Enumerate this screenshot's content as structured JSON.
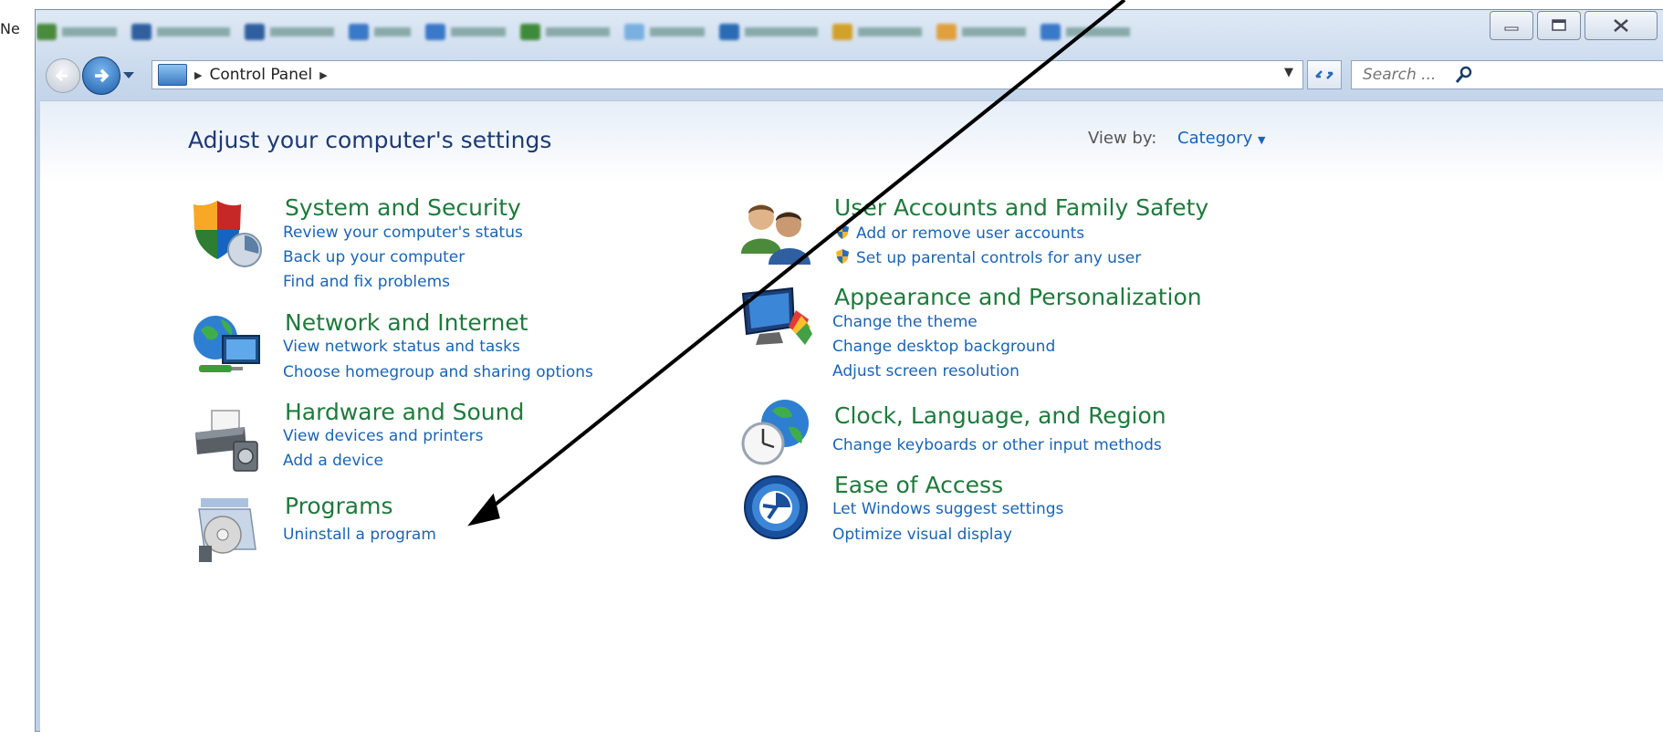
{
  "edge_text": "Ne",
  "window_controls": {
    "minimize": "minimize",
    "maximize": "maximize",
    "close": "close"
  },
  "nav": {
    "address": "Control Panel",
    "search_placeholder": "Search ..."
  },
  "main": {
    "heading": "Adjust your computer's settings",
    "view_by_label": "View by:",
    "view_by_value": "Category"
  },
  "categories_left": [
    {
      "title": "System and Security",
      "links": [
        "Review your computer's status",
        "Back up your computer",
        "Find and fix problems"
      ]
    },
    {
      "title": "Network and Internet",
      "links": [
        "View network status and tasks",
        "Choose homegroup and sharing options"
      ]
    },
    {
      "title": "Hardware and Sound",
      "links": [
        "View devices and printers",
        "Add a device"
      ]
    },
    {
      "title": "Programs",
      "links": [
        "Uninstall a program"
      ]
    }
  ],
  "categories_right": [
    {
      "title": "User Accounts and Family Safety",
      "links": [
        "Add or remove user accounts",
        "Set up parental controls for any user"
      ]
    },
    {
      "title": "Appearance and Personalization",
      "links": [
        "Change the theme",
        "Change desktop background",
        "Adjust screen resolution"
      ]
    },
    {
      "title": "Clock, Language, and Region",
      "links": [
        "Change keyboards or other input methods"
      ]
    },
    {
      "title": "Ease of Access",
      "links": [
        "Let Windows suggest settings",
        "Optimize visual display"
      ]
    }
  ],
  "colors": {
    "link": "#1a64b4",
    "category_title": "#1f7a3c",
    "heading": "#1e3a74"
  }
}
